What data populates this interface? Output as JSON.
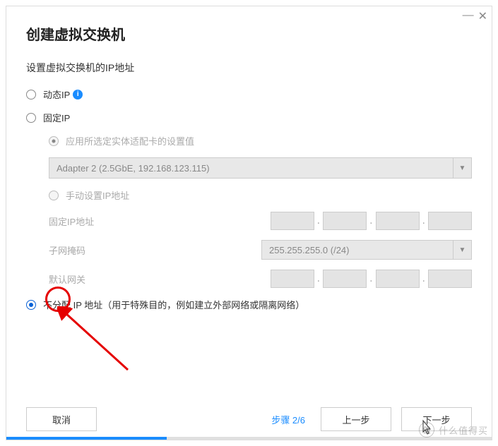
{
  "dialog": {
    "title": "创建虚拟交换机",
    "section_title": "设置虚拟交换机的IP地址"
  },
  "options": {
    "dynamic_ip": "动态IP",
    "static_ip": "固定IP",
    "use_adapter_settings": "应用所选定实体适配卡的设置值",
    "adapter_value": "Adapter 2 (2.5GbE, 192.168.123.115)",
    "manual_ip": "手动设置IP地址",
    "fixed_ip_label": "固定IP地址",
    "subnet_label": "子网掩码",
    "subnet_value": "255.255.255.0 (/24)",
    "gateway_label": "默认网关",
    "no_ip": "不分配 IP 地址（用于特殊目的，例如建立外部网络或隔离网络）"
  },
  "footer": {
    "cancel": "取消",
    "step": "步骤 2/6",
    "prev": "上一步",
    "next": "下一步"
  },
  "watermark": {
    "logo": "值",
    "text": "什么值得买"
  }
}
